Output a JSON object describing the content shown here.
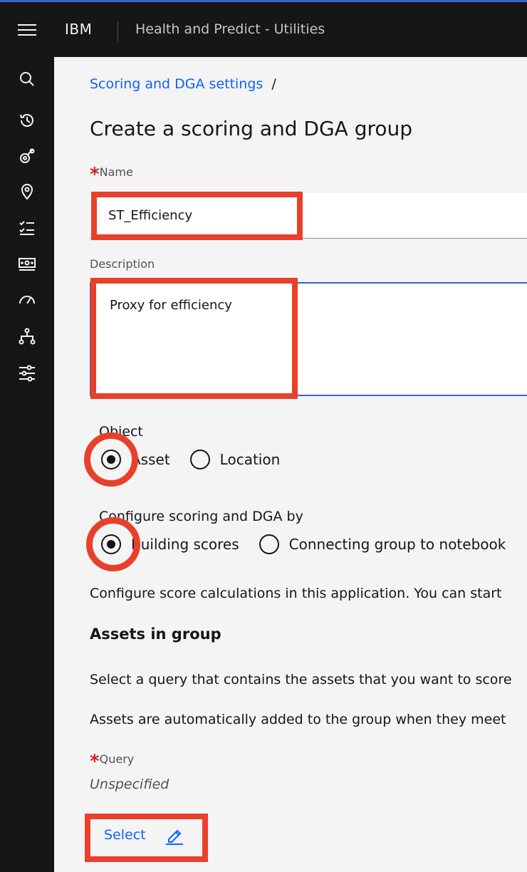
{
  "header": {
    "brand": "IBM",
    "app_title": "Health and Predict - Utilities"
  },
  "sidebar": {
    "items": [
      {
        "icon": "search-icon"
      },
      {
        "icon": "history-icon"
      },
      {
        "icon": "satellite-icon"
      },
      {
        "icon": "location-pin-icon"
      },
      {
        "icon": "checklist-icon"
      },
      {
        "icon": "money-icon"
      },
      {
        "icon": "gauge-icon"
      },
      {
        "icon": "hierarchy-icon"
      },
      {
        "icon": "sliders-icon"
      }
    ]
  },
  "breadcrumb": {
    "link": "Scoring and DGA settings",
    "separator": "/"
  },
  "page_title": "Create a scoring and DGA group",
  "form": {
    "required_marker": "*",
    "name_label": "Name",
    "name_value": "ST_Efficiency",
    "description_label": "Description",
    "description_value": "Proxy for efficiency",
    "object": {
      "label": "Object",
      "options": [
        "Asset",
        "Location"
      ],
      "selected": "Asset"
    },
    "configure": {
      "label": "Configure scoring and DGA by",
      "options": [
        "Building scores",
        "Connecting group to notebook"
      ],
      "selected": "Building scores"
    },
    "configure_info": "Configure score calculations in this application. You can start",
    "assets_heading": "Assets in group",
    "assets_info_1": "Select a query that contains the assets that you want to score",
    "assets_info_2": "Assets are automatically added to the group when they meet",
    "query_label": "Query",
    "query_value": "Unspecified",
    "select_label": "Select"
  },
  "colors": {
    "accent": "#0f62fe",
    "highlight": "#e8402b",
    "required": "#da1e28",
    "topbar": "#161616"
  }
}
